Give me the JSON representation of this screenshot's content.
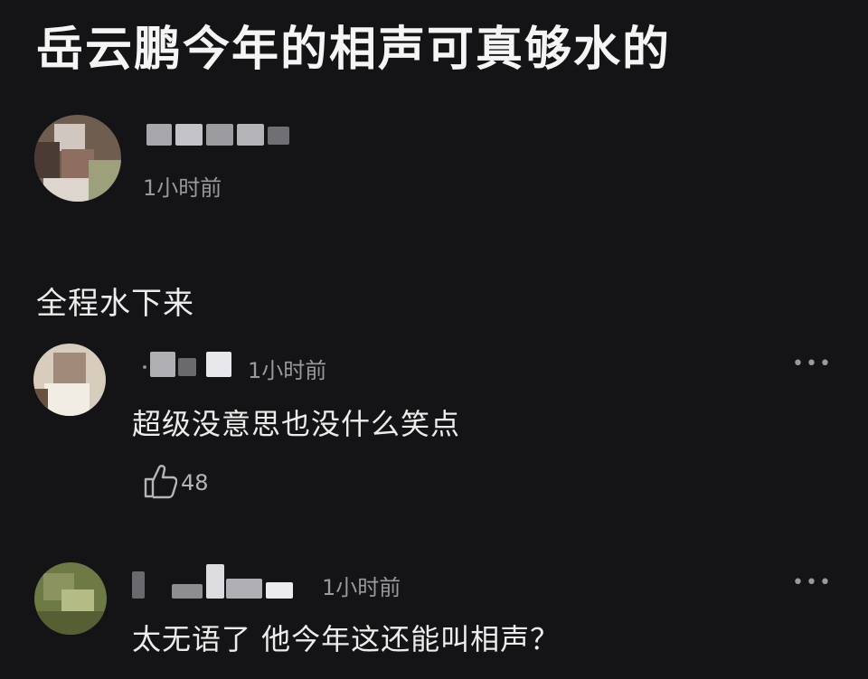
{
  "headline": "岳云鹏今年的相声可真够水的",
  "main_comment": {
    "timestamp": "1小时前",
    "text": "全程水下来"
  },
  "replies": [
    {
      "timestamp": "1小时前",
      "text": "超级没意思也没什么笑点",
      "likes": "48"
    },
    {
      "timestamp": "1小时前",
      "text": "太无语了 他今年这还能叫相声？"
    }
  ],
  "more_label": "•••",
  "icons": {
    "like": "thumbs-up-icon",
    "more": "more-dots-icon"
  }
}
